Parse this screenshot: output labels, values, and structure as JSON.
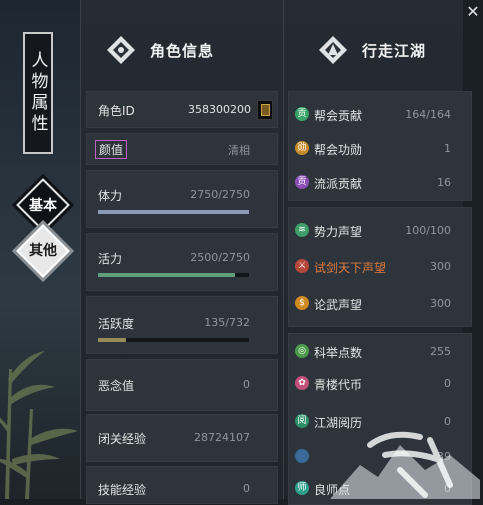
{
  "sidebar": {
    "title": "人物属性",
    "tabs": [
      {
        "label": "基本",
        "active": true
      },
      {
        "label": "其他",
        "active": false
      }
    ]
  },
  "character_info": {
    "header": "角色信息",
    "id_label": "角色ID",
    "id_value": "358300200",
    "appearance_label": "颜值",
    "appearance_value": "清相",
    "stats": [
      {
        "label": "体力",
        "value": "2750/2750",
        "fill": 1.0,
        "color": "#8c9bb5"
      },
      {
        "label": "活力",
        "value": "2500/2750",
        "fill": 0.909,
        "color": "#5f9e7a"
      },
      {
        "label": "活跃度",
        "value": "135/732",
        "fill": 0.184,
        "color": "#9a8a5a"
      },
      {
        "label": "恶念值",
        "value": "0"
      },
      {
        "label": "闭关经验",
        "value": "28724107"
      },
      {
        "label": "技能经验",
        "value": "0"
      }
    ]
  },
  "jianghu": {
    "header": "行走江湖",
    "group1": [
      {
        "label": "帮会贡献",
        "value": "164/164",
        "icon": "guild-contribution-icon",
        "glyph": "贡",
        "color": "#3aa36a"
      },
      {
        "label": "帮会功勋",
        "value": "1",
        "icon": "guild-merit-icon",
        "glyph": "勋",
        "color": "#c58a2a"
      },
      {
        "label": "流派贡献",
        "value": "16",
        "icon": "sect-contribution-icon",
        "glyph": "贡",
        "color": "#8a4fb5"
      }
    ],
    "group2": [
      {
        "label": "势力声望",
        "value": "100/100",
        "icon": "faction-reputation-icon",
        "glyph": "≋",
        "color": "#3f9e6a"
      },
      {
        "label": "试剑天下声望",
        "value": "300",
        "icon": "sword-trial-icon",
        "glyph": "⚔",
        "color": "#b5473a",
        "highlight": true
      },
      {
        "label": "论武声望",
        "value": "300",
        "icon": "martial-debate-icon",
        "glyph": "$",
        "color": "#d08a22"
      }
    ],
    "group3": [
      {
        "label": "科举点数",
        "value": "255",
        "icon": "exam-points-icon",
        "glyph": "◎",
        "color": "#4a9a4a"
      },
      {
        "label": "青楼代币",
        "value": "0",
        "icon": "pavilion-token-icon",
        "glyph": "✿",
        "color": "#c0507a"
      },
      {
        "label": "江湖阅历",
        "value": "0",
        "icon": "jianghu-experience-icon",
        "glyph": "阅",
        "color": "#2f8f6a"
      },
      {
        "label": "",
        "value": "39",
        "icon": "partial-icon-1",
        "glyph": "",
        "color": "#3a6a9a"
      },
      {
        "label": "良师点",
        "value": "0",
        "icon": "mentor-points-icon",
        "glyph": "师",
        "color": "#2f9e8a"
      }
    ]
  }
}
